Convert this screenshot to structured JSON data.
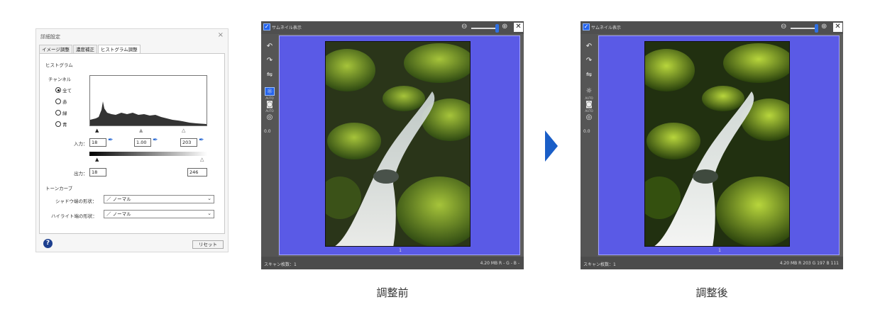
{
  "dialog": {
    "title": "詳細設定",
    "tabs": [
      "イメージ調整",
      "濃度補正",
      "ヒストグラム調整"
    ],
    "histogram_label": "ヒストグラム",
    "channel_label": "チャンネル",
    "channels": [
      "全て",
      "赤",
      "緑",
      "青"
    ],
    "selected_channel": "全て",
    "input_label": "入力：",
    "input_values": [
      "18",
      "1.00",
      "203"
    ],
    "output_label": "出力：",
    "output_values": [
      "18",
      "246"
    ],
    "tone_curve_label": "トーンカーブ",
    "shadow_label": "シャドウ端の形状：",
    "shadow_value": "／ ノーマル",
    "highlight_label": "ハイライト端の形状：",
    "highlight_value": "／ ノーマル",
    "reset_label": "リセット",
    "help_glyph": "?",
    "close_glyph": "×"
  },
  "before": {
    "thumb_label": "サムネイル表示",
    "auto_label": "AUTO",
    "zero_value": "0.0",
    "page_number": "1",
    "scan_count": "スキャン枚数：1",
    "stats": "4.20 MB    R  -    G  -    B  -",
    "caption": "調整前"
  },
  "after": {
    "thumb_label": "サムネイル表示",
    "auto_label": "AUTO",
    "zero_value": "0.0",
    "page_number": "1",
    "scan_count": "スキャン枚数：1",
    "stats": "4.20 MB    R  203   G  197   B  111",
    "caption": "調整後"
  },
  "colors": {
    "accent": "#1a5ec7",
    "preview_bg": "#5a5ae6",
    "window_bg": "#5e5e5e"
  },
  "icons": [
    "rotate-left-icon",
    "rotate-right-icon",
    "mirror-icon",
    "auto-exposure-icon",
    "auto-color-icon",
    "restore-icon",
    "zoom-out-icon",
    "zoom-in-icon",
    "close-icon",
    "eyedropper-icon",
    "help-icon"
  ]
}
